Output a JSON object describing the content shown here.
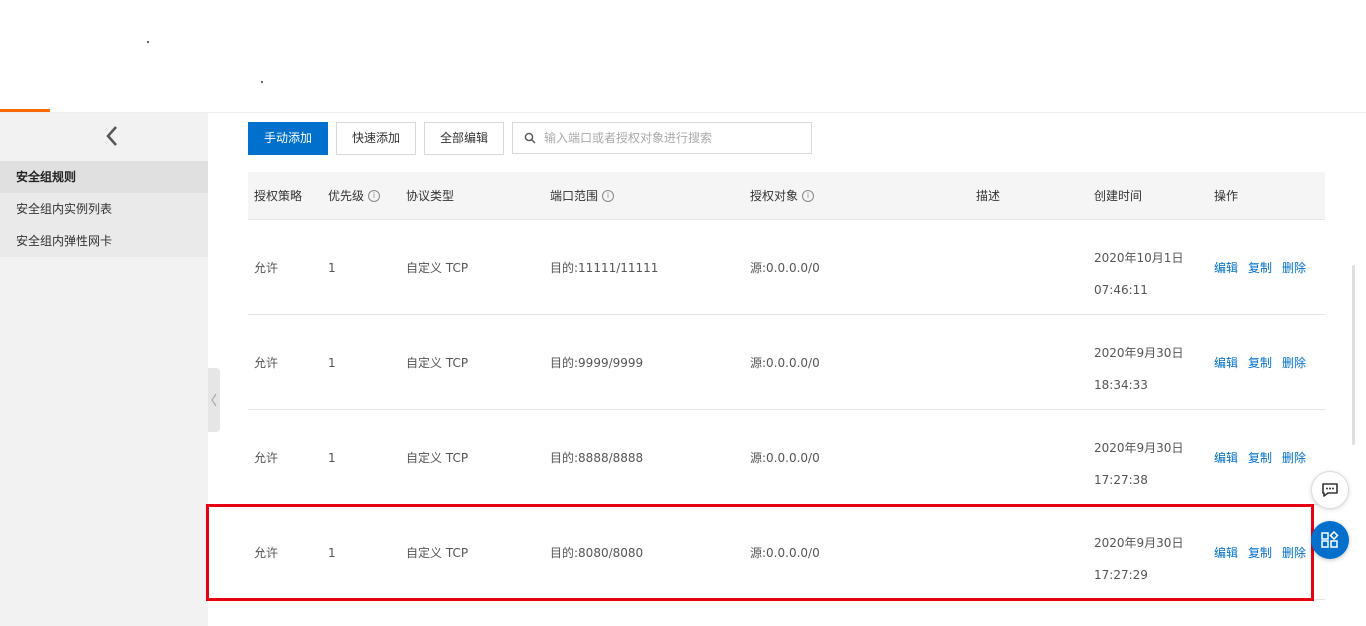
{
  "colors": {
    "primary": "#0070cc",
    "accent": "#ff6a00",
    "highlight": "#e60012"
  },
  "sidebar": {
    "items": [
      {
        "label": "安全组规则",
        "active": true
      },
      {
        "label": "安全组内实例列表",
        "active": false
      },
      {
        "label": "安全组内弹性网卡",
        "active": false
      }
    ]
  },
  "toolbar": {
    "manual_add": "手动添加",
    "quick_add": "快速添加",
    "edit_all": "全部编辑",
    "search_placeholder": "输入端口或者授权对象进行搜索"
  },
  "table": {
    "headers": {
      "policy": "授权策略",
      "priority": "优先级",
      "protocol": "协议类型",
      "port_range": "端口范围",
      "auth_object": "授权对象",
      "description": "描述",
      "created": "创建时间",
      "actions": "操作"
    },
    "actions": {
      "edit": "编辑",
      "copy": "复制",
      "delete": "删除"
    },
    "rows": [
      {
        "policy": "允许",
        "priority": "1",
        "protocol": "自定义 TCP",
        "port_range": "目的:11111/11111",
        "auth_object": "源:0.0.0.0/0",
        "description": "",
        "created_date": "2020年10月1日",
        "created_time": "07:46:11"
      },
      {
        "policy": "允许",
        "priority": "1",
        "protocol": "自定义 TCP",
        "port_range": "目的:9999/9999",
        "auth_object": "源:0.0.0.0/0",
        "description": "",
        "created_date": "2020年9月30日",
        "created_time": "18:34:33"
      },
      {
        "policy": "允许",
        "priority": "1",
        "protocol": "自定义 TCP",
        "port_range": "目的:8888/8888",
        "auth_object": "源:0.0.0.0/0",
        "description": "",
        "created_date": "2020年9月30日",
        "created_time": "17:27:38"
      },
      {
        "policy": "允许",
        "priority": "1",
        "protocol": "自定义 TCP",
        "port_range": "目的:8080/8080",
        "auth_object": "源:0.0.0.0/0",
        "description": "",
        "created_date": "2020年9月30日",
        "created_time": "17:27:29"
      }
    ]
  },
  "icons": {
    "back": "chevron-left-icon",
    "search": "search-icon",
    "info": "info-icon",
    "chat": "chat-icon",
    "apps": "apps-icon",
    "collapse": "chevron-left-icon"
  }
}
